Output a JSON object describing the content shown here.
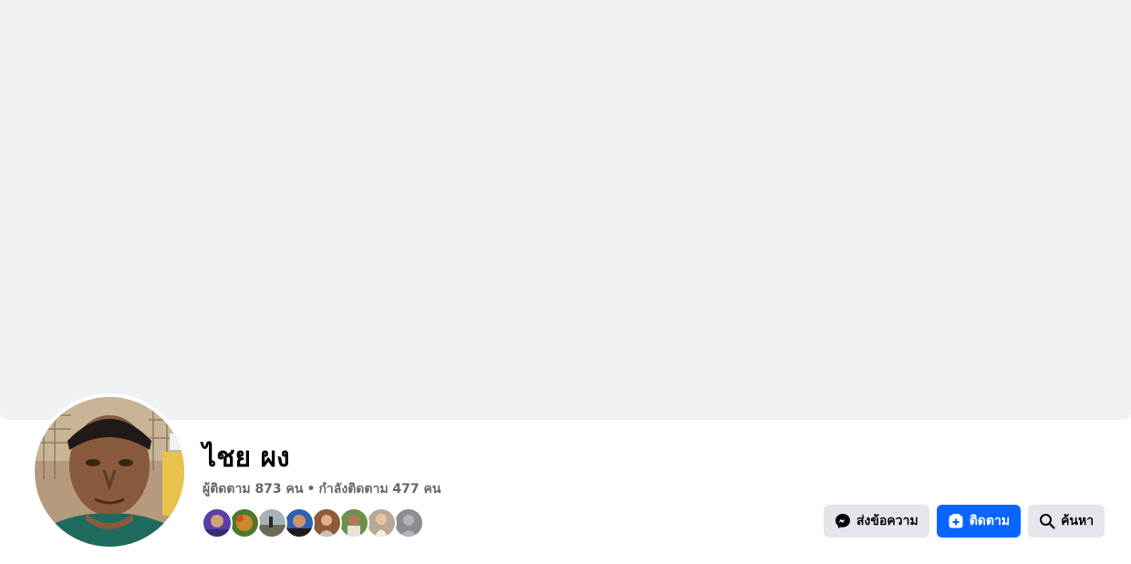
{
  "profile": {
    "name": "ไชย ผง",
    "followers_label": "ผู้ติดตาม 873 คน",
    "separator": "•",
    "following_label": "กำลังติดตาม 477 คน"
  },
  "friend_avatars": [
    {
      "name": "friend-avatar-1",
      "color": "#5b3fa8"
    },
    {
      "name": "friend-avatar-2",
      "color": "#b8892f"
    },
    {
      "name": "friend-avatar-3",
      "color": "#8a8f7a"
    },
    {
      "name": "friend-avatar-4",
      "color": "#2f5fb3"
    },
    {
      "name": "friend-avatar-5",
      "color": "#8e5a3a"
    },
    {
      "name": "friend-avatar-6",
      "color": "#6f7f5a"
    },
    {
      "name": "friend-avatar-7",
      "color": "#a08070"
    },
    {
      "name": "friend-avatar-8",
      "color": "#8a8d91"
    }
  ],
  "actions": {
    "message_label": "ส่งข้อความ",
    "follow_label": "ติดตาม",
    "search_label": "ค้นหา"
  },
  "colors": {
    "cover": "#f0f1f5",
    "primary": "#0866ff",
    "button_grey": "#e4e6eb",
    "muted_text": "#65676b"
  },
  "icons": {
    "message": "messenger-icon",
    "follow": "follow-add-icon",
    "search": "search-icon"
  }
}
